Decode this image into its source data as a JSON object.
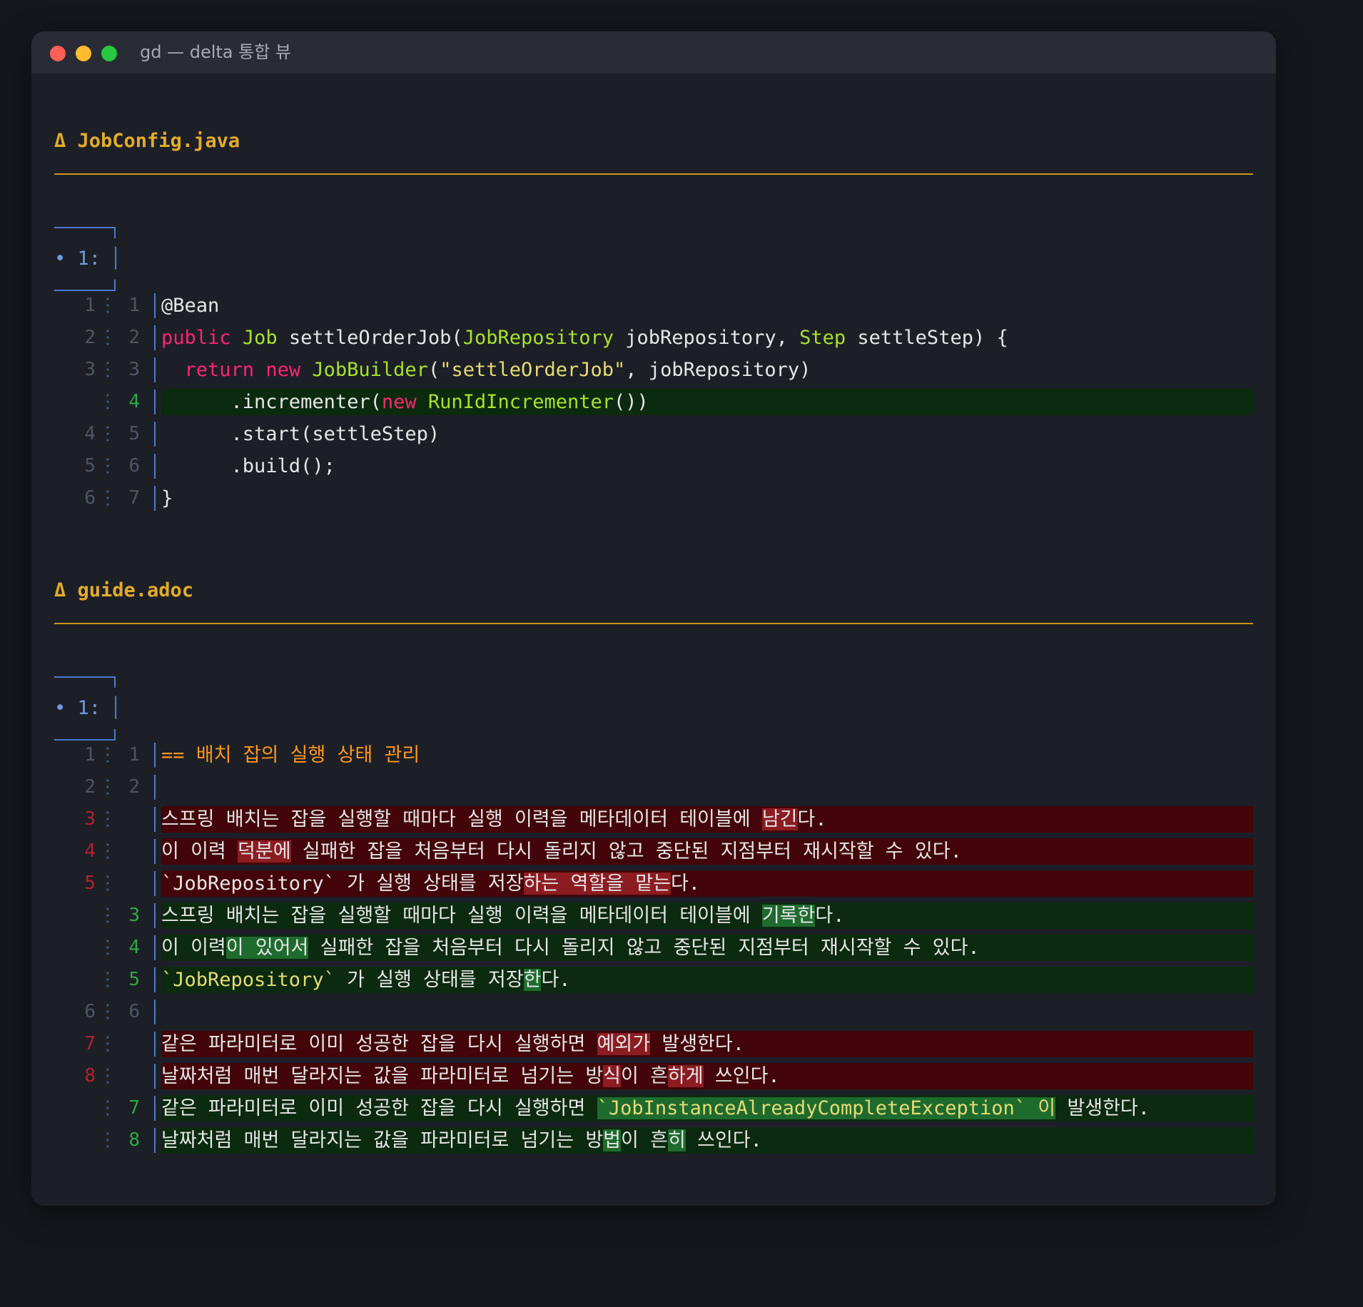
{
  "window": {
    "title": "gd — delta 통합 뷰"
  },
  "files": [
    {
      "name": "Δ JobConfig.java",
      "hunk_label": "• 1:",
      "lines": [
        {
          "old": "1",
          "new": "1",
          "type": "ctx",
          "segments": [
            {
              "t": "@Bean"
            }
          ]
        },
        {
          "old": "2",
          "new": "2",
          "type": "ctx",
          "segments": [
            {
              "t": "public",
              "c": "kw"
            },
            {
              "t": " "
            },
            {
              "t": "Job",
              "c": "ty"
            },
            {
              "t": " settleOrderJob("
            },
            {
              "t": "JobRepository",
              "c": "ty"
            },
            {
              "t": " jobRepository, "
            },
            {
              "t": "Step",
              "c": "ty"
            },
            {
              "t": " settleStep) {"
            }
          ]
        },
        {
          "old": "3",
          "new": "3",
          "type": "ctx",
          "segments": [
            {
              "t": "  "
            },
            {
              "t": "return",
              "c": "kw"
            },
            {
              "t": " "
            },
            {
              "t": "new",
              "c": "kw"
            },
            {
              "t": " "
            },
            {
              "t": "JobBuilder",
              "c": "ty"
            },
            {
              "t": "("
            },
            {
              "t": "\"settleOrderJob\"",
              "c": "str"
            },
            {
              "t": ", jobRepository)"
            }
          ]
        },
        {
          "old": "",
          "new": "4",
          "type": "plus",
          "segments": [
            {
              "t": "      .incrementer("
            },
            {
              "t": "new",
              "c": "kw"
            },
            {
              "t": " "
            },
            {
              "t": "RunIdIncrementer",
              "c": "ty"
            },
            {
              "t": "())"
            }
          ]
        },
        {
          "old": "4",
          "new": "5",
          "type": "ctx",
          "segments": [
            {
              "t": "      .start(settleStep)"
            }
          ]
        },
        {
          "old": "5",
          "new": "6",
          "type": "ctx",
          "segments": [
            {
              "t": "      .build();"
            }
          ]
        },
        {
          "old": "6",
          "new": "7",
          "type": "ctx",
          "segments": [
            {
              "t": "}"
            }
          ]
        }
      ]
    },
    {
      "name": "Δ guide.adoc",
      "hunk_label": "• 1:",
      "lines": [
        {
          "old": "1",
          "new": "1",
          "type": "ctx",
          "segments": [
            {
              "t": "== 배치 잡의 실행 상태 관리",
              "c": "heading"
            }
          ]
        },
        {
          "old": "2",
          "new": "2",
          "type": "ctx",
          "segments": [
            {
              "t": ""
            }
          ]
        },
        {
          "old": "3",
          "new": "",
          "type": "minus",
          "segments": [
            {
              "t": "스프링 배치는 잡을 실행할 때마다 실행 이력을 메타데이터 테이블에 "
            },
            {
              "t": "남긴",
              "c": "emph-minus"
            },
            {
              "t": "다."
            }
          ]
        },
        {
          "old": "4",
          "new": "",
          "type": "minus",
          "segments": [
            {
              "t": "이 이력 "
            },
            {
              "t": "덕분에",
              "c": "emph-minus"
            },
            {
              "t": " 실패한 잡을 처음부터 다시 돌리지 않고 중단된 지점부터 재시작할 수 있다."
            }
          ]
        },
        {
          "old": "5",
          "new": "",
          "type": "minus",
          "segments": [
            {
              "t": "`JobRepository` 가 실행 상태를 저장"
            },
            {
              "t": "하는 역할을 맡는",
              "c": "emph-minus"
            },
            {
              "t": "다."
            }
          ]
        },
        {
          "old": "",
          "new": "3",
          "type": "plus",
          "segments": [
            {
              "t": "스프링 배치는 잡을 실행할 때마다 실행 이력을 메타데이터 테이블에 "
            },
            {
              "t": "기록한",
              "c": "emph-plus"
            },
            {
              "t": "다."
            }
          ]
        },
        {
          "old": "",
          "new": "4",
          "type": "plus",
          "segments": [
            {
              "t": "이 이력"
            },
            {
              "t": "이 있어서",
              "c": "emph-plus"
            },
            {
              "t": " 실패한 잡을 처음부터 다시 돌리지 않고 중단된 지점부터 재시작할 수 있다."
            }
          ]
        },
        {
          "old": "",
          "new": "5",
          "type": "plus",
          "segments": [
            {
              "t": "`JobRepository`",
              "c": "str"
            },
            {
              "t": " 가 실행 상태를 저장"
            },
            {
              "t": "한",
              "c": "emph-plus"
            },
            {
              "t": "다."
            }
          ]
        },
        {
          "old": "6",
          "new": "6",
          "type": "ctx",
          "segments": [
            {
              "t": ""
            }
          ]
        },
        {
          "old": "7",
          "new": "",
          "type": "minus",
          "segments": [
            {
              "t": "같은 파라미터로 이미 성공한 잡을 다시 실행하면 "
            },
            {
              "t": "예외가",
              "c": "emph-minus"
            },
            {
              "t": " 발생한다."
            }
          ]
        },
        {
          "old": "8",
          "new": "",
          "type": "minus",
          "segments": [
            {
              "t": "날짜처럼 매번 달라지는 값을 파라미터로 넘기는 방"
            },
            {
              "t": "식",
              "c": "emph-minus"
            },
            {
              "t": "이 흔"
            },
            {
              "t": "하게",
              "c": "emph-minus"
            },
            {
              "t": " 쓰인다."
            }
          ]
        },
        {
          "old": "",
          "new": "7",
          "type": "plus",
          "segments": [
            {
              "t": "같은 파라미터로 이미 성공한 잡을 다시 실행하면 "
            },
            {
              "t": "`JobInstanceAlreadyCompleteException` 이",
              "c": "emph-plus-code"
            },
            {
              "t": " 발생한다."
            }
          ]
        },
        {
          "old": "",
          "new": "8",
          "type": "plus",
          "segments": [
            {
              "t": "날짜처럼 매번 달라지는 값을 파라미터로 넘기는 방"
            },
            {
              "t": "법",
              "c": "emph-plus"
            },
            {
              "t": "이 흔"
            },
            {
              "t": "히",
              "c": "emph-plus"
            },
            {
              "t": " 쓰인다."
            }
          ]
        }
      ]
    }
  ],
  "colors": {
    "file_header": "#e2ac2a",
    "plus_bg": "#0b2a0f",
    "minus_bg": "#430509",
    "plus_emph": "#1f6b2e",
    "minus_emph": "#8b1c22",
    "keyword": "#f92672",
    "type": "#a6e22e",
    "string": "#e6db74",
    "heading": "#fd971f"
  }
}
